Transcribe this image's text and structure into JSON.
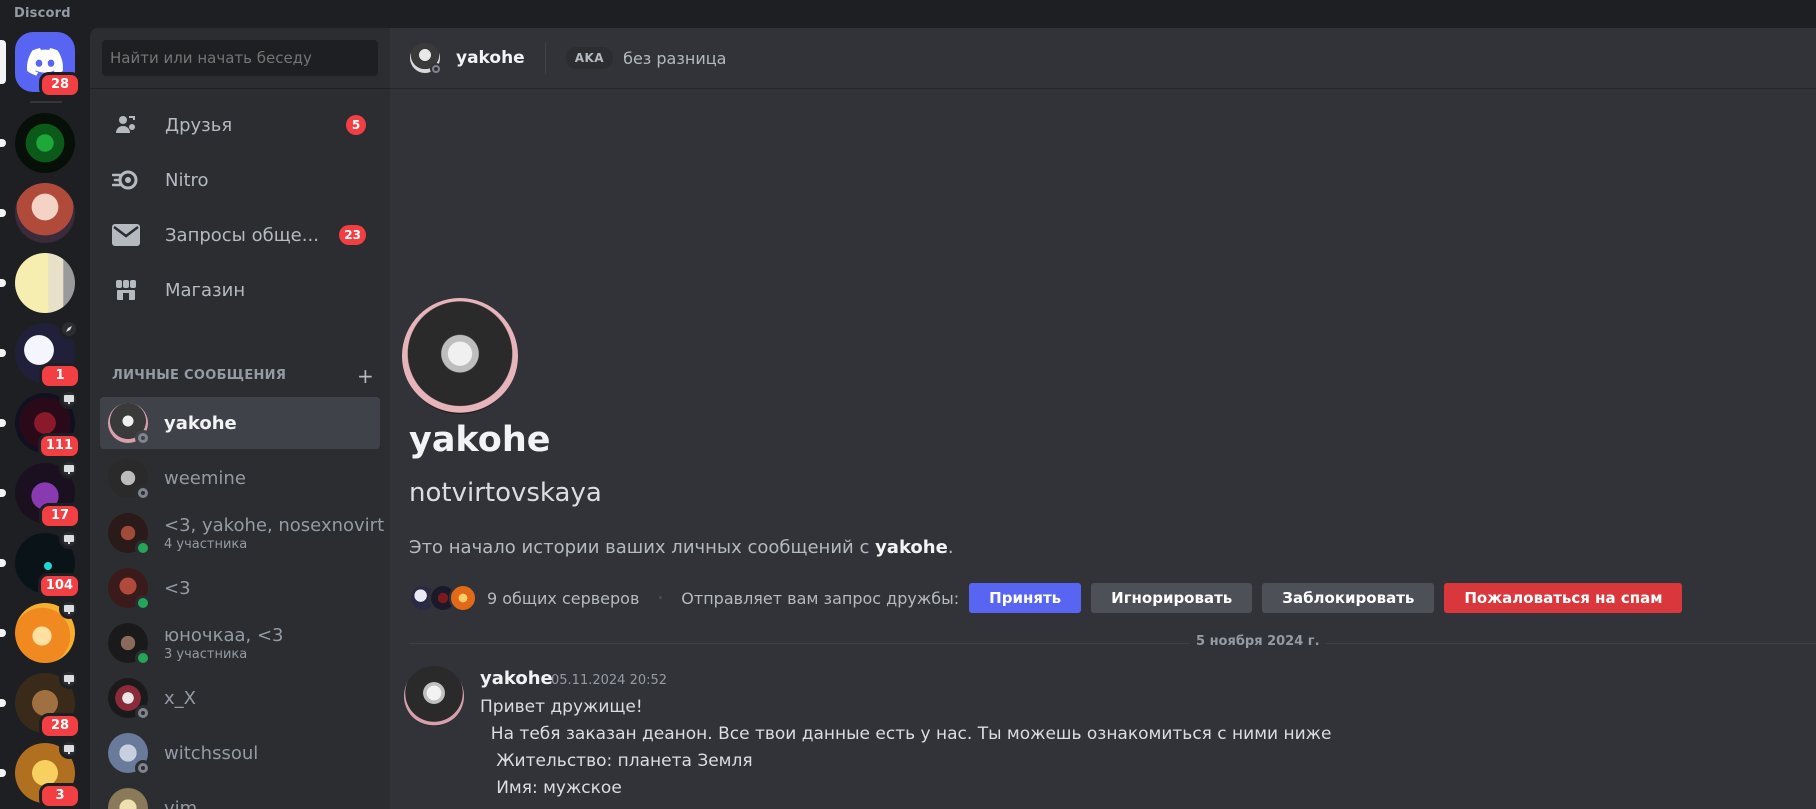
{
  "app": {
    "title": "Discord"
  },
  "rail": {
    "home_badge": "28",
    "servers": [
      {
        "name": "server-green-flower",
        "badge": "",
        "mini_icon": ""
      },
      {
        "name": "server-anime-girl",
        "badge": "",
        "mini_icon": ""
      },
      {
        "name": "server-cartoon-face",
        "badge": "",
        "mini_icon": ""
      },
      {
        "name": "server-moon",
        "badge": "1",
        "mini_icon": "rocket-icon"
      },
      {
        "name": "server-red-dark",
        "badge": "111",
        "mini_icon": "stage-icon"
      },
      {
        "name": "server-purple-fan",
        "badge": "17",
        "mini_icon": "stage-icon"
      },
      {
        "name": "server-crescent",
        "badge": "104",
        "mini_icon": "stage-icon"
      },
      {
        "name": "server-orange-art",
        "badge": "",
        "mini_icon": "stage-icon"
      },
      {
        "name": "server-brown-art",
        "badge": "28",
        "mini_icon": "stage-icon"
      },
      {
        "name": "server-butterfly",
        "badge": "3",
        "mini_icon": "stage-icon"
      }
    ]
  },
  "sidebar": {
    "search_placeholder": "Найти или начать беседу",
    "nav": [
      {
        "label": "Друзья",
        "badge": "5",
        "icon": "friends-icon"
      },
      {
        "label": "Nitro",
        "badge": "",
        "icon": "nitro-icon"
      },
      {
        "label": "Запросы обще...",
        "badge": "23",
        "icon": "envelope-icon"
      },
      {
        "label": "Магазин",
        "badge": "",
        "icon": "shop-icon"
      }
    ],
    "dm_header": "ЛИЧНЫЕ СООБЩЕНИЯ",
    "dm_add": "+",
    "dms": [
      {
        "name": "yakohe",
        "sub": "",
        "status": "offline",
        "active": true
      },
      {
        "name": "weemine",
        "sub": "",
        "status": "offline",
        "active": false
      },
      {
        "name": "<3, yakohe, nosexnovirt",
        "sub": "4 участника",
        "status": "online",
        "active": false
      },
      {
        "name": "<3",
        "sub": "",
        "status": "online",
        "active": false
      },
      {
        "name": "юночкаа, <3",
        "sub": "3 участника",
        "status": "online",
        "active": false
      },
      {
        "name": "x_X",
        "sub": "",
        "status": "offline",
        "active": false
      },
      {
        "name": "witchssoul",
        "sub": "",
        "status": "offline",
        "active": false
      },
      {
        "name": "vim",
        "sub": "",
        "status": "idle",
        "active": false
      }
    ]
  },
  "topbar": {
    "name": "yakohe",
    "aka": "AKA",
    "alias": "без разница"
  },
  "profile": {
    "display_name": "yakohe",
    "username": "notvirtovskaya",
    "intro_prefix": "Это начало истории ваших личных сообщений с ",
    "intro_name": "yakohe",
    "intro_suffix": ".",
    "mutual_servers": "9 общих серверов",
    "bullet": "•",
    "request_label": "Отправляет вам запрос дружбы:",
    "accept": "Принять",
    "ignore": "Игнорировать",
    "block": "Заблокировать",
    "report_spam": "Пожаловаться на спам"
  },
  "divider_date": "5 ноября 2024 г.",
  "message": {
    "author": "yakohe",
    "timestamp": "05.11.2024 20:52",
    "lines": [
      "Привет дружище!",
      "  На тебя заказан деанон. Все твои данные есть у нас. Ты можешь ознакомиться с ними ниже",
      "   Жительство: планета Земля",
      "   Имя: мужское"
    ]
  },
  "colors": {
    "blurple": "#5865f2",
    "danger": "#da373c",
    "badge_red": "#f23f43",
    "online": "#23a55a"
  }
}
